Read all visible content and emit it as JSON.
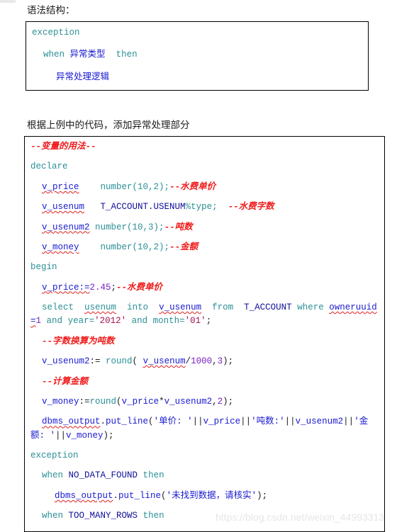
{
  "document": {
    "intro_text": "语法结构：",
    "second_text": "根据上例中的代码，添加异常处理部分",
    "watermark": "https://blog.csdn.net/weixin_44993313"
  },
  "syntax_block": {
    "lines": [
      {
        "id": "line-exception",
        "text": "exception"
      },
      {
        "id": "line-when-then",
        "text": "when 异常类型  then"
      },
      {
        "id": "line-handler",
        "text": "异常处理逻辑"
      }
    ],
    "tokens": {
      "exception": "exception",
      "when": "when",
      "exception_type": "异常类型",
      "then": "then",
      "handler_logic": "异常处理逻辑"
    }
  },
  "example_block": {
    "lines": [
      {
        "id": "line-01",
        "text": "--变量的用法--"
      },
      {
        "id": "line-02",
        "text": "declare"
      },
      {
        "id": "line-03",
        "text": "  v_price   number(10,2);--水费单价"
      },
      {
        "id": "line-04",
        "text": "  v_usenum  T_ACCOUNT.USENUM%type;  --水费字数"
      },
      {
        "id": "line-05",
        "text": "  v_usenum2 number(10,3);--吨数"
      },
      {
        "id": "line-06",
        "text": "  v_money   number(10,2);--金额"
      },
      {
        "id": "line-07",
        "text": "begin"
      },
      {
        "id": "line-08",
        "text": "  v_price:=2.45;--水费单价"
      },
      {
        "id": "line-09",
        "text": "  select  usenum  into  v_usenum  from  T_ACCOUNT where owneruuid=1 and year='2012' and month='01';"
      },
      {
        "id": "line-10",
        "text": "  --字数换算为吨数"
      },
      {
        "id": "line-11",
        "text": "  v_usenum2:= round( v_usenum/1000,3);"
      },
      {
        "id": "line-12",
        "text": "  --计算金额"
      },
      {
        "id": "line-13",
        "text": "  v_money:=round(v_price*v_usenum2,2);"
      },
      {
        "id": "line-14",
        "text": "  dbms_output.put_line('单价: '||v_price||'吨数:'||v_usenum2||'金额: '||v_money);"
      },
      {
        "id": "line-15",
        "text": "exception"
      },
      {
        "id": "line-16",
        "text": "  when NO_DATA_FOUND then"
      },
      {
        "id": "line-17",
        "text": "     dbms_output.put_line('未找到数据，请核实');"
      },
      {
        "id": "line-18",
        "text": "  when TOO_MANY_ROWS then"
      }
    ],
    "tokens": {
      "c_var_usage": "--变量的用法--",
      "kw_declare": "declare",
      "v_price": "v_price",
      "number_10_2": "number(10,2);",
      "c_water_price": "--水费单价",
      "v_usenum": "v_usenum",
      "t_account_usenum": "T_ACCOUNT.USENUM",
      "pct_type": "%type;",
      "c_water_count": "--水费字数",
      "v_usenum2": "v_usenum2",
      "number_10_3": "number(10,3);",
      "c_ton": "--吨数",
      "v_money": "v_money",
      "c_money": "--金额",
      "kw_begin": "begin",
      "assign_price": "v_price:=",
      "price_value": "2.45",
      "kw_select": "select",
      "col_usenum": "usenum",
      "kw_into": "into",
      "kw_from": "from",
      "tbl_t_account": "T_ACCOUNT",
      "kw_where": "where",
      "cond_owneruuid": "owneruuid=",
      "owneruuid_value": "1",
      "kw_and": "and",
      "cond_year": "year=",
      "year_value": "'2012'",
      "cond_month": "month=",
      "month_value": "'01'",
      "c_convert_ton": "--字数换算为吨数",
      "fn_round": "round",
      "divisor_1000": "1000",
      "precision_3": "3",
      "precision_2": "2",
      "c_calc_money": "--计算金额",
      "dbms_output": "dbms_output",
      "put_line": "put_line",
      "str_unit_price": "'单价: '",
      "str_ton_count": "'吨数:'",
      "str_money": "'金额: '",
      "kw_exception": "exception",
      "kw_when": "when",
      "exc_no_data_found": "NO_DATA_FOUND",
      "exc_too_many_rows": "TOO_MANY_ROWS",
      "kw_then": "then",
      "str_not_found": "'未找到数据，请核实'"
    }
  },
  "colors": {
    "keyword": "#2a8f96",
    "identifier": "#1a1ad0",
    "number": "#7a1ec4",
    "comment": "#ef1c1c",
    "chinese_string": "#1a1ad0",
    "border": "#000000",
    "text": "#1a1a1a",
    "watermark": "#e6e6e6"
  }
}
